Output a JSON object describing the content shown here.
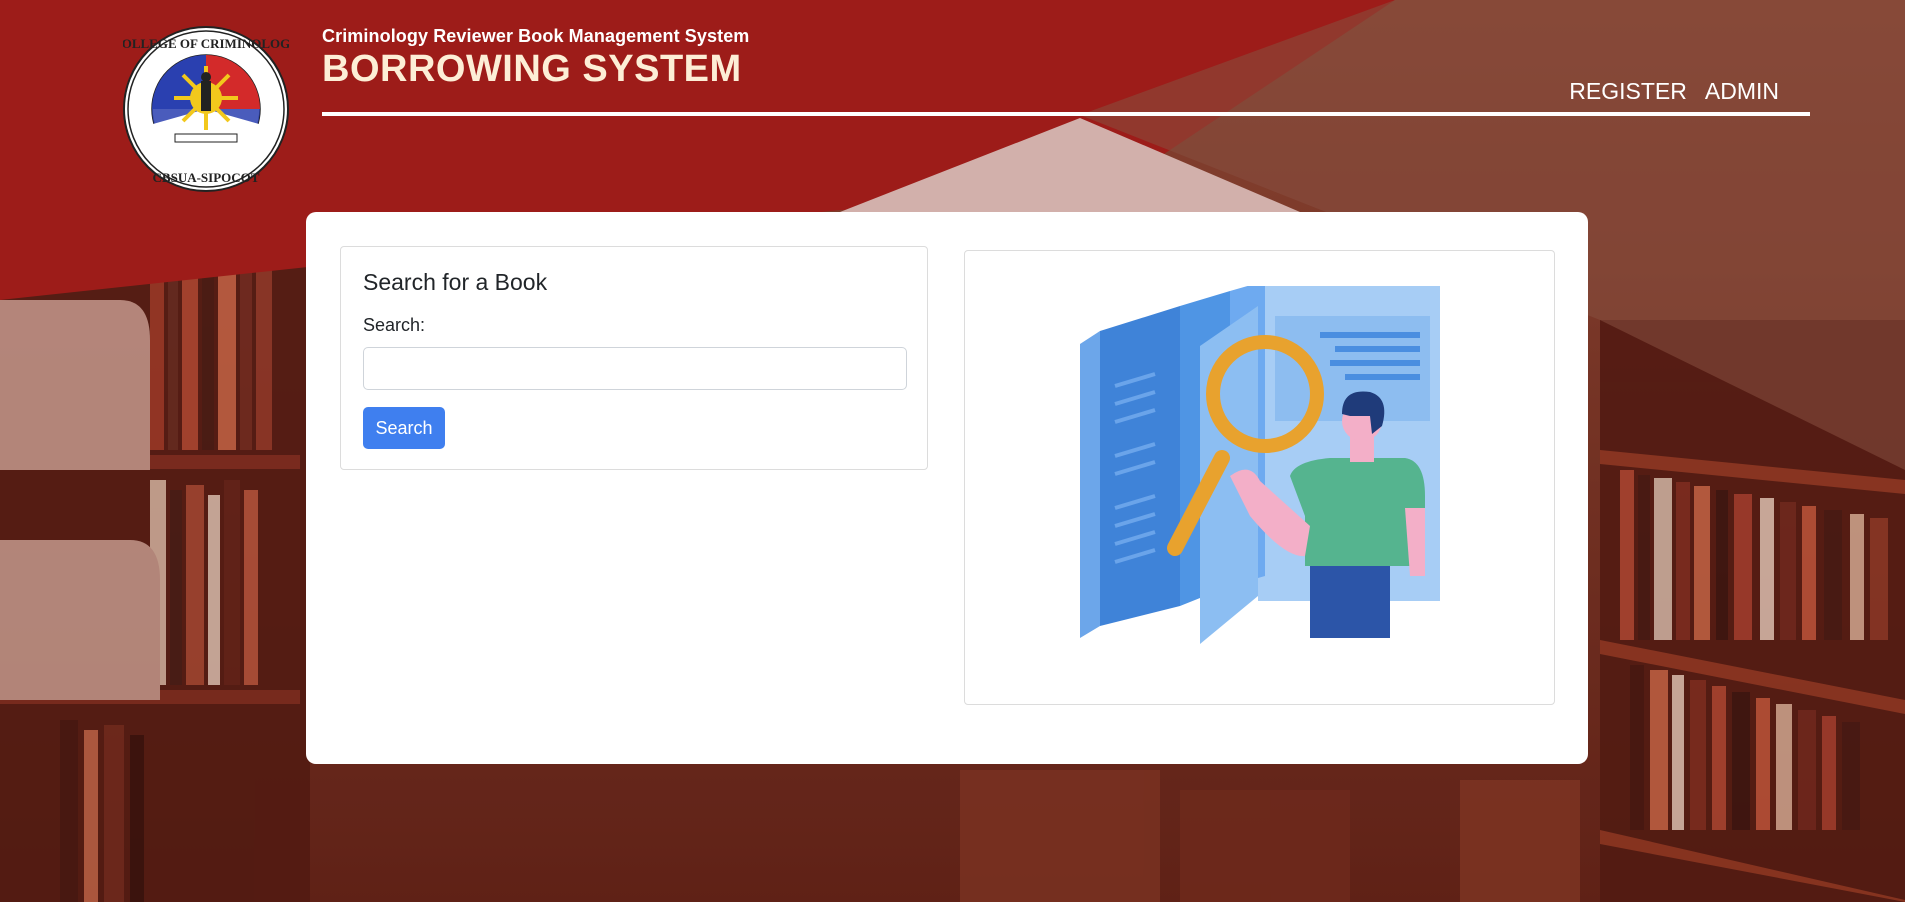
{
  "header": {
    "subtitle": "Criminology Reviewer Book Management System",
    "title": "BORROWING SYSTEM",
    "logo_icon": "college-of-criminology-seal"
  },
  "nav": {
    "register": "REGISTER",
    "admin": "ADMIN"
  },
  "search_panel": {
    "heading": "Search for a Book",
    "label": "Search:",
    "input_value": "",
    "button": "Search"
  },
  "illustration": {
    "icon": "book-search-illustration"
  },
  "colors": {
    "brand_red": "#a51c1a",
    "button_blue": "#3f7fef"
  }
}
